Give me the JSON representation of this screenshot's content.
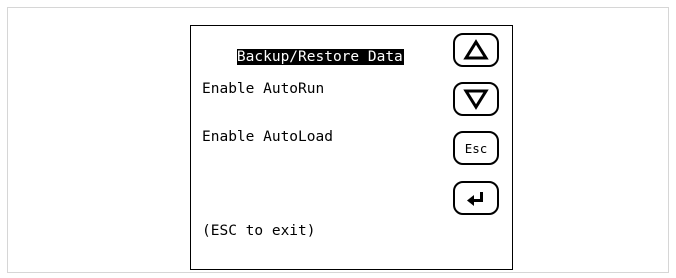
{
  "menu": {
    "items": [
      {
        "label": "Backup/Restore Data",
        "selected": true
      },
      {
        "label": "Enable AutoRun",
        "selected": false
      },
      {
        "label": "Enable AutoLoad",
        "selected": false
      }
    ],
    "hint": "(ESC to exit)"
  },
  "buttons": {
    "up_icon": "triangle-up-icon",
    "down_icon": "triangle-down-icon",
    "esc_label": "Esc",
    "enter_icon": "enter-arrow-icon"
  }
}
